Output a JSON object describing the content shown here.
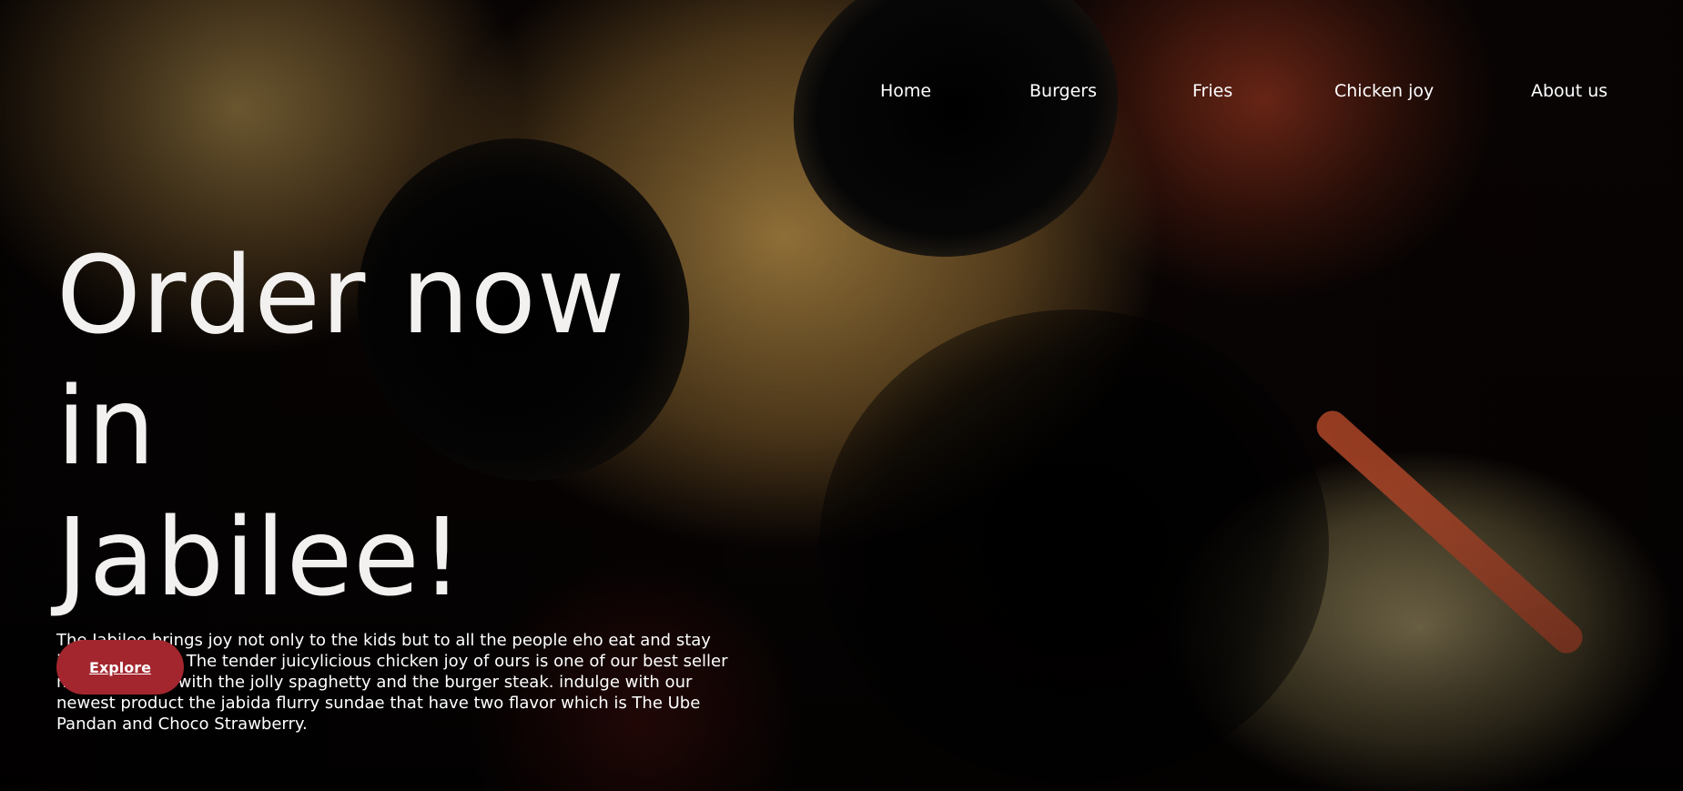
{
  "nav": {
    "items": [
      {
        "label": "Home"
      },
      {
        "label": "Burgers"
      },
      {
        "label": "Fries"
      },
      {
        "label": "Chicken joy"
      },
      {
        "label": "About us"
      }
    ]
  },
  "hero": {
    "title_line1": "Order now in",
    "title_line2": "Jabilee!",
    "description": "The Jabilee brings joy not only to the kids but to all the people eho eat and stay in our fastfood. The tender juicylicious chicken joy of ours is one of our best seller meal together with the jolly spaghetty and the burger steak. indulge with our newest product the jabida flurry sundae that have two flavor which is The Ube Pandan and Choco Strawberry.",
    "cta_label": "Explore"
  },
  "colors": {
    "cta_background": "#a3262e",
    "text": "#ffffff",
    "page_background": "#050202"
  }
}
